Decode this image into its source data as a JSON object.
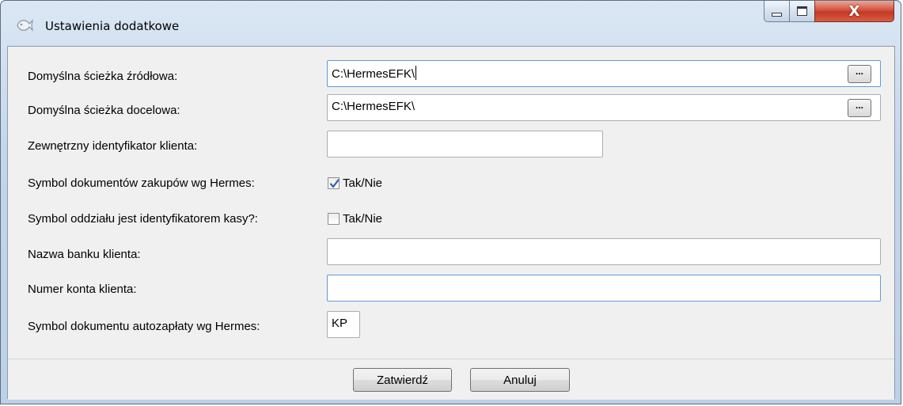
{
  "window": {
    "title": "Ustawienia dodatkowe",
    "minimize_label": "",
    "close_label": "X"
  },
  "form": {
    "source_path": {
      "label": "Domyślna ścieżka źródłowa:",
      "value": "C:\\HermesEFK\\",
      "browse_label": "..."
    },
    "target_path": {
      "label": "Domyślna ścieżka docelowa:",
      "value": "C:\\HermesEFK\\",
      "browse_label": "..."
    },
    "client_id": {
      "label": "Zewnętrzny identyfikator klienta:",
      "value": ""
    },
    "purchase_symbol": {
      "label": "Symbol dokumentów zakupów wg Hermes:",
      "checkbox_label": "Tak/Nie",
      "checked": true
    },
    "branch_symbol": {
      "label": "Symbol oddziału jest identyfikatorem kasy?:",
      "checkbox_label": "Tak/Nie",
      "checked": false
    },
    "bank_name": {
      "label": "Nazwa banku klienta:",
      "value": ""
    },
    "account_number": {
      "label": "Numer konta klienta:",
      "value": ""
    },
    "autopay_symbol": {
      "label": "Symbol dokumentu autozapłaty wg Hermes:",
      "value": "KP"
    }
  },
  "buttons": {
    "confirm": "Zatwierdź",
    "cancel": "Anuluj"
  },
  "icons": {
    "app": "fish-app-icon",
    "minimize": "minimize-icon",
    "maximize": "maximize-icon",
    "close": "close-icon",
    "check": "checkmark-icon"
  },
  "colors": {
    "close_button": "#c23a24",
    "check_mark": "#2b5fb0",
    "focus_border": "#5d9bd8"
  }
}
